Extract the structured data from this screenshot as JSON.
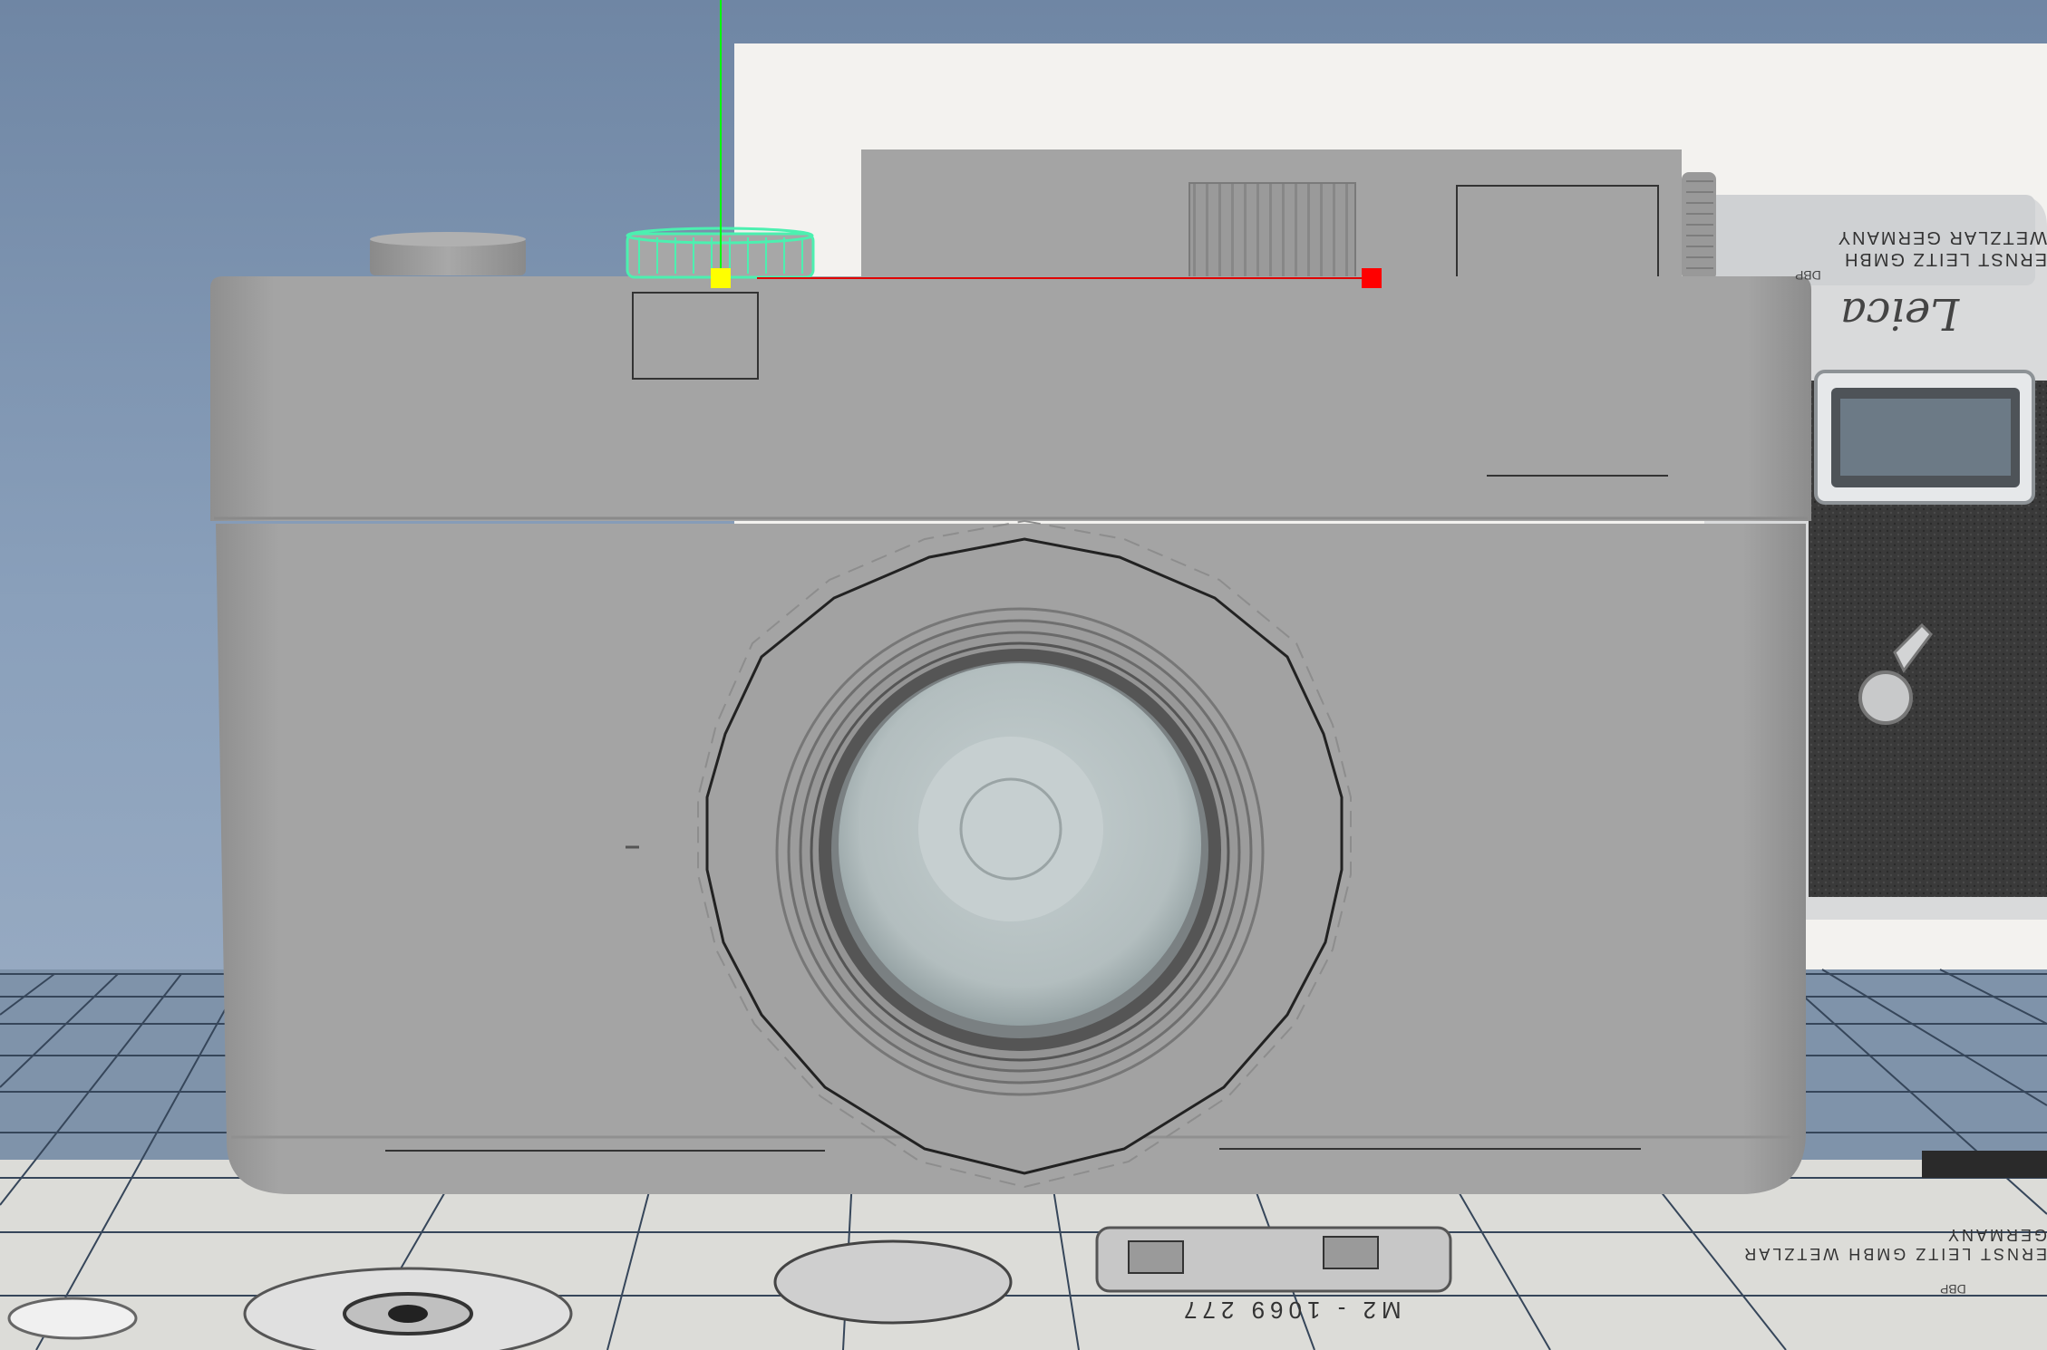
{
  "viewport": {
    "background_top": "#6f86a4",
    "background_bottom": "#a2b3c8",
    "grid_color": "#2f3c4c"
  },
  "reference_photo": {
    "engraving_line1": "ERNST LEITZ GMBH",
    "engraving_line2": "WETZLAR GERMANY",
    "engraving_dbp": "DBP",
    "script_logo": "Leica",
    "floor_top_text": "ERNST LEITZ GMBH WETZLAR GERMANY",
    "floor_serial": "M2 - 1069 277",
    "floor_dbp": "DBP"
  },
  "model": {
    "body_color": "#a3a3a3",
    "lens_glass_color": "#b8c3c4"
  },
  "manipulator": {
    "x_axis_color": "#ff0000",
    "y_axis_color": "#00ff00",
    "pivot_color": "#ffff00",
    "selection_color": "#4cf0b0"
  }
}
